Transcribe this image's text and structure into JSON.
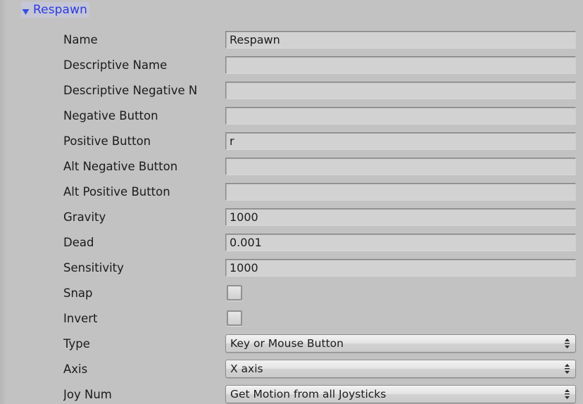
{
  "window": {
    "background_color": "#c2c2c2",
    "accent_color": "#2c3ae0"
  },
  "foldout": {
    "label": "Respawn",
    "expanded": true,
    "arrow_icon": "triangle-down-icon"
  },
  "rows": [
    {
      "label": "Name",
      "control": "text",
      "value": "Respawn",
      "placeholder": ""
    },
    {
      "label": "Descriptive Name",
      "control": "text",
      "value": "",
      "placeholder": ""
    },
    {
      "label": "Descriptive Negative N",
      "control": "text",
      "value": "",
      "placeholder": ""
    },
    {
      "label": "Negative Button",
      "control": "text",
      "value": "",
      "placeholder": ""
    },
    {
      "label": "Positive Button",
      "control": "text",
      "value": "r",
      "placeholder": ""
    },
    {
      "label": "Alt Negative Button",
      "control": "text",
      "value": "",
      "placeholder": ""
    },
    {
      "label": "Alt Positive Button",
      "control": "text",
      "value": "",
      "placeholder": ""
    },
    {
      "label": "Gravity",
      "control": "text",
      "value": "1000",
      "placeholder": ""
    },
    {
      "label": "Dead",
      "control": "text",
      "value": "0.001",
      "placeholder": ""
    },
    {
      "label": "Sensitivity",
      "control": "text",
      "value": "1000",
      "placeholder": ""
    },
    {
      "label": "Snap",
      "control": "checkbox",
      "value": "",
      "checked": false
    },
    {
      "label": "Invert",
      "control": "checkbox",
      "value": "",
      "checked": false
    },
    {
      "label": "Type",
      "control": "dropdown",
      "value": "Key or Mouse Button",
      "placeholder": ""
    },
    {
      "label": "Axis",
      "control": "dropdown",
      "value": "X axis",
      "placeholder": ""
    },
    {
      "label": "Joy Num",
      "control": "dropdown",
      "value": "Get Motion from all Joysticks",
      "placeholder": ""
    }
  ]
}
